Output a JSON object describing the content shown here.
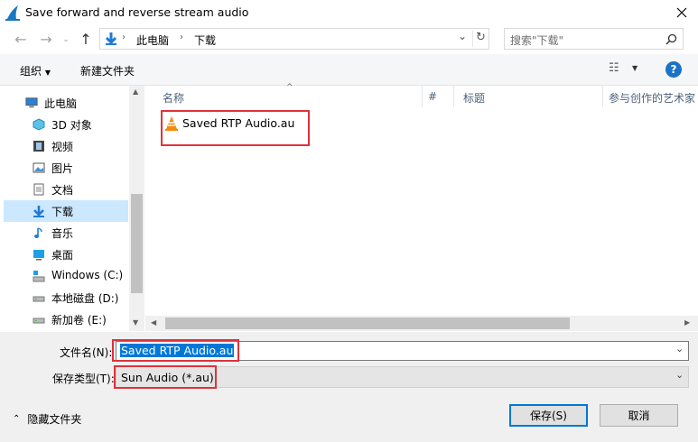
{
  "window": {
    "title": "Save forward and reverse stream audio"
  },
  "address": {
    "breadcrumb": [
      "此电脑",
      "下载"
    ],
    "search_placeholder": "搜索\"下载\""
  },
  "toolbar": {
    "organize_label": "组织",
    "new_folder_label": "新建文件夹",
    "help_label": "?"
  },
  "nav": {
    "items": [
      {
        "label": "此电脑",
        "icon": "computer-icon"
      },
      {
        "label": "3D 对象",
        "icon": "3d-objects-icon"
      },
      {
        "label": "视频",
        "icon": "video-icon"
      },
      {
        "label": "图片",
        "icon": "pictures-icon"
      },
      {
        "label": "文档",
        "icon": "documents-icon"
      },
      {
        "label": "下载",
        "icon": "download-icon",
        "selected": true
      },
      {
        "label": "音乐",
        "icon": "music-icon"
      },
      {
        "label": "桌面",
        "icon": "desktop-icon"
      },
      {
        "label": "Windows (C:)",
        "icon": "windows-drive-icon"
      },
      {
        "label": "本地磁盘 (D:)",
        "icon": "drive-icon"
      },
      {
        "label": "新加卷 (E:)",
        "icon": "drive-icon"
      }
    ]
  },
  "columns": [
    "名称",
    "#",
    "标题",
    "参与创作的艺术家"
  ],
  "files": [
    {
      "name": "Saved RTP Audio.au",
      "icon": "vlc-icon"
    }
  ],
  "form": {
    "filename_label": "文件名(N):",
    "filename_value": "Saved RTP Audio.au",
    "filetype_label": "保存类型(T):",
    "filetype_value": "Sun Audio (*.au)"
  },
  "footer": {
    "hide_folders_label": "隐藏文件夹",
    "save_label": "保存(S)",
    "cancel_label": "取消"
  },
  "colors": {
    "accent": "#0078d7",
    "selection": "#cce8ff",
    "highlight_red": "#e0323c"
  }
}
